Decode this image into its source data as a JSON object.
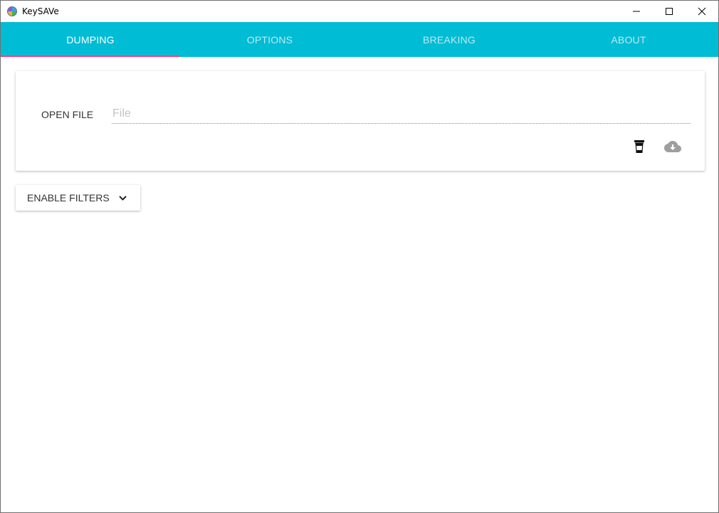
{
  "window": {
    "title": "KeySAVe"
  },
  "tabs": [
    {
      "label": "DUMPING",
      "active": true
    },
    {
      "label": "OPTIONS",
      "active": false
    },
    {
      "label": "BREAKING",
      "active": false
    },
    {
      "label": "ABOUT",
      "active": false
    }
  ],
  "colors": {
    "accent": "#00bcd4",
    "tab_indicator": "#ff4081"
  },
  "dump": {
    "open_file_label": "OPEN FILE",
    "file_input": {
      "value": "",
      "placeholder": "File"
    },
    "actions": [
      {
        "icon": "cup-icon",
        "enabled": true
      },
      {
        "icon": "cloud-download-icon",
        "enabled": false
      }
    ]
  },
  "filters": {
    "button_label": "ENABLE FILTERS",
    "icon": "chevron-down-icon"
  }
}
